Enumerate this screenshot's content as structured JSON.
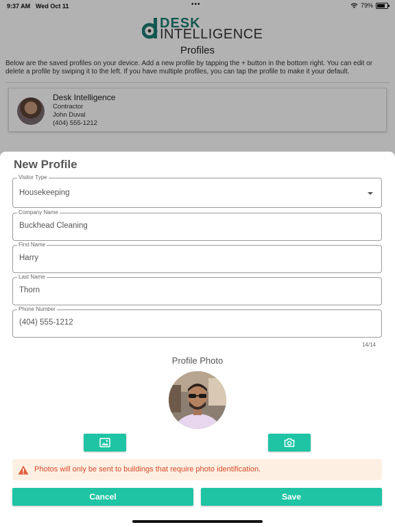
{
  "status_bar": {
    "time": "9:37 AM",
    "date": "Wed Oct 11",
    "battery": "79%"
  },
  "app": {
    "logo_top": "DESK",
    "logo_bottom": "INTELLIGENCE",
    "page_title": "Profiles",
    "description": "Below are the saved profiles on your device. Add a new profile by tapping the + button in the bottom right. You can edit or delete a profile by swiping it to the left. If you have multiple profiles, you can tap the profile to make it your default."
  },
  "saved_profile": {
    "company": "Desk Intelligence",
    "type": "Contractor",
    "name": "John Duval",
    "phone": "(404) 555-1212"
  },
  "sheet": {
    "title": "New Profile",
    "fields": {
      "visitor_type": {
        "label": "Visitor Type",
        "value": "Housekeeping"
      },
      "company_name": {
        "label": "Company Name",
        "value": "Buckhead Cleaning"
      },
      "first_name": {
        "label": "First Name",
        "value": "Harry"
      },
      "last_name": {
        "label": "Last Name",
        "value": "Thorn"
      },
      "phone_number": {
        "label": "Phone Number",
        "value": "(404) 555-1212",
        "counter": "14/14"
      }
    },
    "photo_title": "Profile Photo",
    "warning": "Photos will only be sent to buildings that require photo identification.",
    "cancel_label": "Cancel",
    "save_label": "Save"
  },
  "icons": {
    "gallery": "image-icon",
    "camera": "camera-icon",
    "warning": "warning-triangle-icon",
    "dropdown": "chevron-down-icon"
  },
  "colors": {
    "accent": "#1ec4a4",
    "brand_green": "#1e7d74",
    "warning_text": "#d9482b",
    "warning_bg": "#fdf0e3"
  }
}
